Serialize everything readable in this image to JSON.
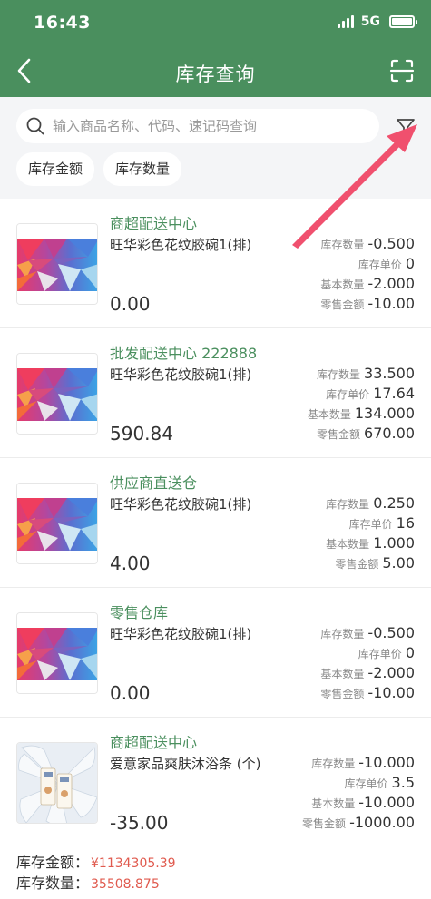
{
  "status_bar": {
    "time": "16:43",
    "network": "5G"
  },
  "nav": {
    "title": "库存查询",
    "back_icon": "chevron-left-icon",
    "scan_icon": "scan-icon"
  },
  "search": {
    "placeholder": "输入商品名称、代码、速记码查询",
    "value": ""
  },
  "chips": [
    "库存金额",
    "库存数量"
  ],
  "stat_labels": {
    "qty": "库存数量",
    "unit_price": "库存单价",
    "base_qty": "基本数量",
    "retail_amount": "零售金额"
  },
  "items": [
    {
      "store": "商超配送中心",
      "product": "旺华彩色花纹胶碗1(排)",
      "image": "geometric",
      "amount": "0.00",
      "qty": "-0.500",
      "unit_price": "0",
      "base_qty": "-2.000",
      "retail_amount": "-10.00"
    },
    {
      "store": "批发配送中心 222888",
      "product": "旺华彩色花纹胶碗1(排)",
      "image": "geometric",
      "amount": "590.84",
      "qty": "33.500",
      "unit_price": "17.64",
      "base_qty": "134.000",
      "retail_amount": "670.00"
    },
    {
      "store": "供应商直送仓",
      "product": "旺华彩色花纹胶碗1(排)",
      "image": "geometric",
      "amount": "4.00",
      "qty": "0.250",
      "unit_price": "16",
      "base_qty": "1.000",
      "retail_amount": "5.00"
    },
    {
      "store": "零售仓库",
      "product": "旺华彩色花纹胶碗1(排)",
      "image": "geometric",
      "amount": "0.00",
      "qty": "-0.500",
      "unit_price": "0",
      "base_qty": "-2.000",
      "retail_amount": "-10.00"
    },
    {
      "store": "商超配送中心",
      "product": "爱意家品爽肤沐浴条 (个)",
      "image": "product-photo",
      "amount": "-35.00",
      "qty": "-10.000",
      "unit_price": "3.5",
      "base_qty": "-10.000",
      "retail_amount": "-1000.00"
    }
  ],
  "footer": {
    "amount_label": "库存金额：",
    "amount_value": "¥1134305.39",
    "qty_label": "库存数量：",
    "qty_value": "35508.875"
  },
  "colors": {
    "brand": "#4a8f5e",
    "accent_red": "#e05a4e",
    "annotation_arrow": "#f0506e"
  }
}
